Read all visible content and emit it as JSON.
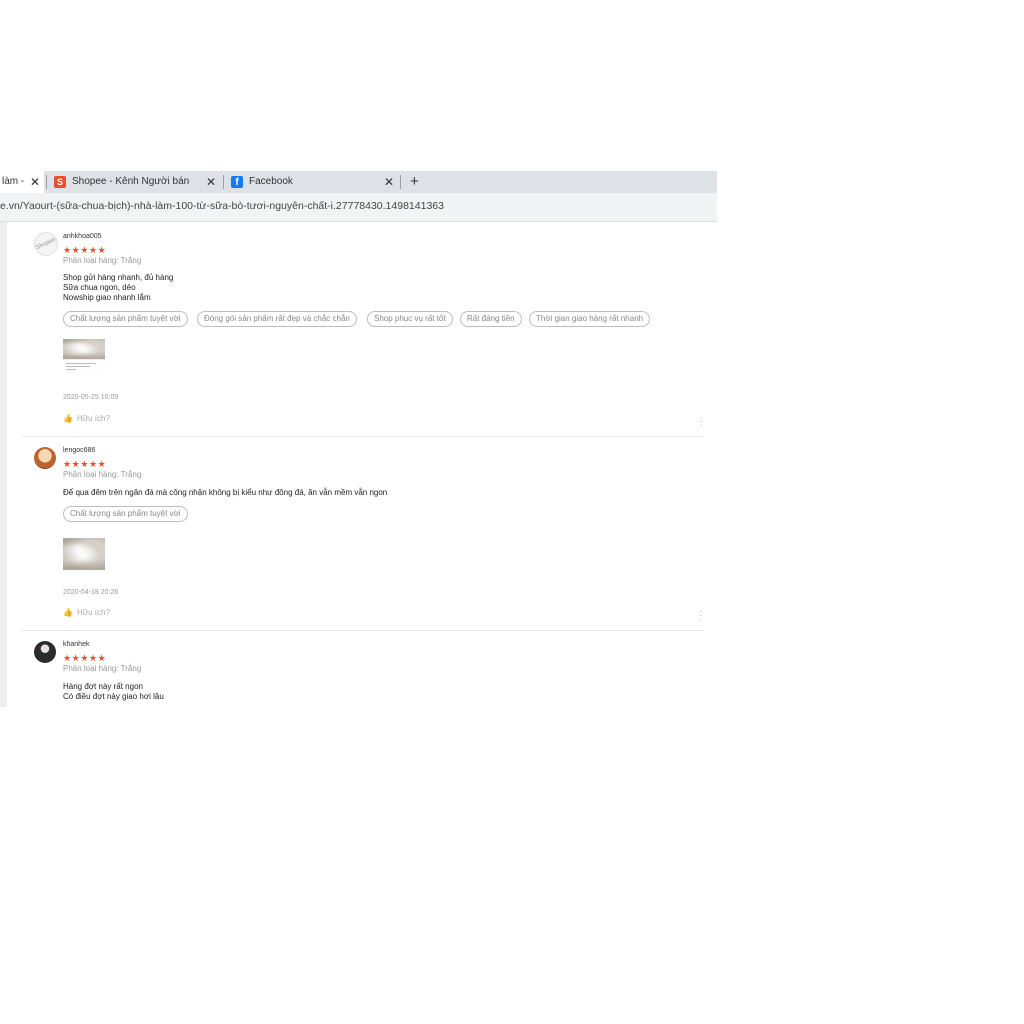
{
  "browser": {
    "active_tab_label": "làm -",
    "tabs": [
      {
        "title": "Shopee - Kênh Người bán",
        "icon": "shopee-favicon"
      },
      {
        "title": "Facebook",
        "icon": "facebook-favicon"
      }
    ],
    "close_glyph": "✕",
    "new_tab_glyph": "+",
    "url": "e.vn/Yaourt-(sữa-chua-bịch)-nhà-làm-100-từ-sữa-bò-tươi-nguyên-chất-i.27778430.1498141363"
  },
  "reviews": [
    {
      "username": "anhkhoa005",
      "stars": "★★★★★",
      "variant": "Phân loại hàng: Trắng",
      "lines": [
        "Shop gửi hàng nhanh, đủ hàng",
        "Sữa chua ngon, dẻo",
        "Nowship giao nhanh lắm"
      ],
      "tags": [
        "Chất lượng sản phẩm tuyệt vời",
        "Đóng gói sản phẩm rất đẹp và chắc chắn",
        "Shop phục vụ rất tốt",
        "Rất đáng tiền",
        "Thời gian giao hàng rất nhanh"
      ],
      "date": "2020-05-25 10:09",
      "helpful": "Hữu ích?"
    },
    {
      "username": "lengoc686",
      "stars": "★★★★★",
      "variant": "Phân loại hàng: Trắng",
      "lines": [
        "Để qua đêm trên ngăn đá mà công nhận không bị kiểu như đông đá, ăn vẫn mềm vẫn ngon"
      ],
      "tags": [
        "Chất lượng sản phẩm tuyệt vời"
      ],
      "date": "2020-04-18 20:26",
      "helpful": "Hữu ích?"
    },
    {
      "username": "khanhek",
      "stars": "★★★★★",
      "variant": "Phân loại hàng: Trắng",
      "lines": [
        "Hàng đợt này rất ngon",
        "Có điều đợt này giao hơi lâu"
      ]
    }
  ],
  "icons": {
    "thumb": "👍",
    "more": "⋮"
  },
  "colors": {
    "star": "#ee4d2d",
    "shopee": "#ee4d2d",
    "facebook": "#1877f2"
  }
}
